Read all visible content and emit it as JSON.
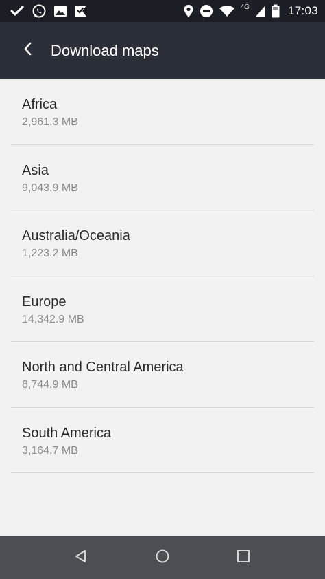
{
  "status_bar": {
    "time": "17:03",
    "network_type": "4G",
    "icons": [
      "check-icon",
      "whatsapp-icon",
      "image-icon",
      "flag-check-icon",
      "location-icon",
      "do-not-disturb-icon",
      "wifi-icon",
      "signal-icon",
      "battery-icon"
    ]
  },
  "app_bar": {
    "title": "Download maps",
    "back_icon": "chevron-left-icon"
  },
  "regions": [
    {
      "name": "Africa",
      "size": "2,961.3 MB"
    },
    {
      "name": "Asia",
      "size": "9,043.9 MB"
    },
    {
      "name": "Australia/Oceania",
      "size": "1,223.2 MB"
    },
    {
      "name": "Europe",
      "size": "14,342.9 MB"
    },
    {
      "name": "North and Central America",
      "size": "8,744.9 MB"
    },
    {
      "name": "South America",
      "size": "3,164.7 MB"
    }
  ],
  "nav_bar": {
    "icons": [
      "back-triangle-icon",
      "home-circle-icon",
      "recents-square-icon"
    ]
  },
  "colors": {
    "status_bar": "#1b1f25",
    "app_bar": "#2a2e36",
    "background": "#f2f2f2",
    "nav_bar": "#4b4f54"
  }
}
